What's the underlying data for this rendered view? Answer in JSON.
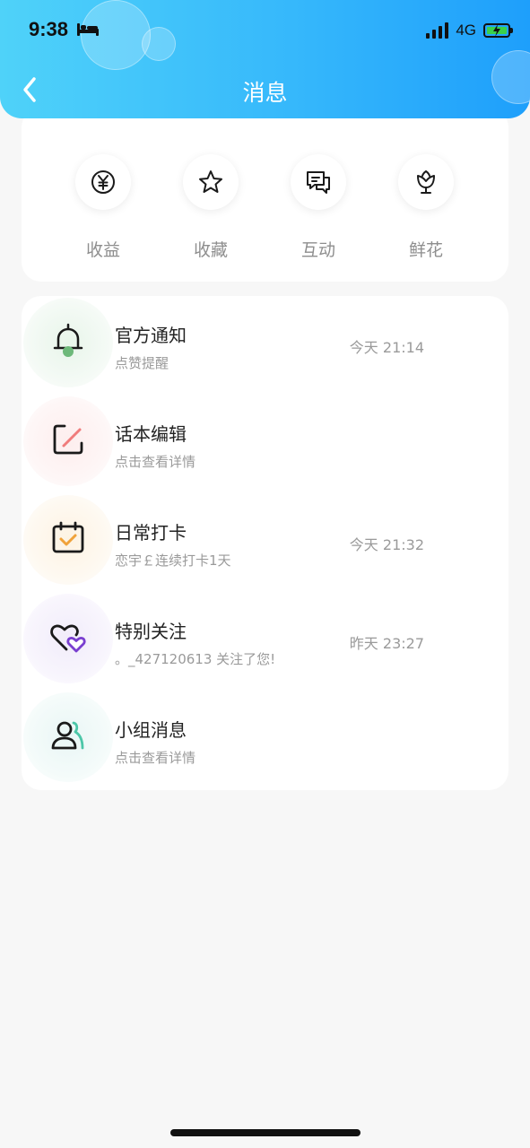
{
  "status_bar": {
    "time": "9:38",
    "network": "4G"
  },
  "header": {
    "title": "消息"
  },
  "quick_actions": [
    {
      "label": "收益",
      "icon": "yen-icon"
    },
    {
      "label": "收藏",
      "icon": "star-icon"
    },
    {
      "label": "互动",
      "icon": "chat-icon"
    },
    {
      "label": "鲜花",
      "icon": "flower-icon"
    }
  ],
  "messages": [
    {
      "title": "官方通知",
      "subtitle": "点赞提醒",
      "time": "今天 21:14",
      "icon": "bell-icon",
      "tint": "#eaf6ec"
    },
    {
      "title": "话本编辑",
      "subtitle": "点击查看详情",
      "time": "",
      "icon": "edit-icon",
      "tint": "#fdeeee"
    },
    {
      "title": "日常打卡",
      "subtitle": "恋宇￡连续打卡1天",
      "time": "今天 21:32",
      "icon": "calendar-check-icon",
      "tint": "#fdf4e6"
    },
    {
      "title": "特别关注",
      "subtitle": "。_427120613 关注了您!",
      "time": "昨天 23:27",
      "icon": "hearts-icon",
      "tint": "#f3eefb"
    },
    {
      "title": "小组消息",
      "subtitle": "点击查看详情",
      "time": "",
      "icon": "group-icon",
      "tint": "#eaf7f6"
    }
  ]
}
